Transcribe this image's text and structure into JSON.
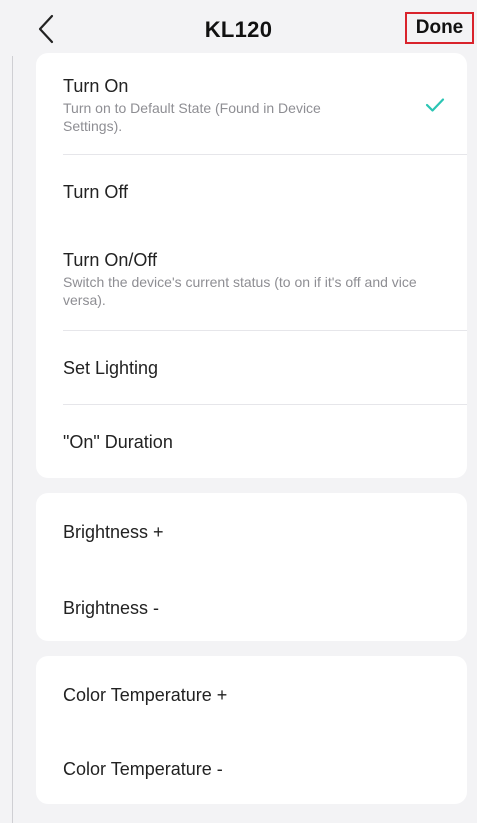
{
  "header": {
    "title": "KL120",
    "done_label": "Done"
  },
  "actions": {
    "turn_on": {
      "label": "Turn On",
      "desc": "Turn on to Default State (Found in Device Settings).",
      "selected": true
    },
    "turn_off": {
      "label": "Turn Off"
    },
    "turn_on_off": {
      "label": "Turn On/Off",
      "desc": "Switch the device's current status (to on if it's off and vice versa)."
    },
    "set_lighting": {
      "label": "Set Lighting"
    },
    "on_duration": {
      "label": "\"On\" Duration"
    }
  },
  "brightness": {
    "plus": {
      "label": "Brightness +"
    },
    "minus": {
      "label": "Brightness -"
    }
  },
  "color_temperature": {
    "plus": {
      "label": "Color Temperature +"
    },
    "minus": {
      "label": "Color Temperature -"
    }
  },
  "icons": {
    "back": "chevron-left-icon",
    "check": "checkmark-icon"
  },
  "colors": {
    "accent_check": "#2bc5b4",
    "done_outline": "#d9232c",
    "background": "#f3f3f5"
  }
}
